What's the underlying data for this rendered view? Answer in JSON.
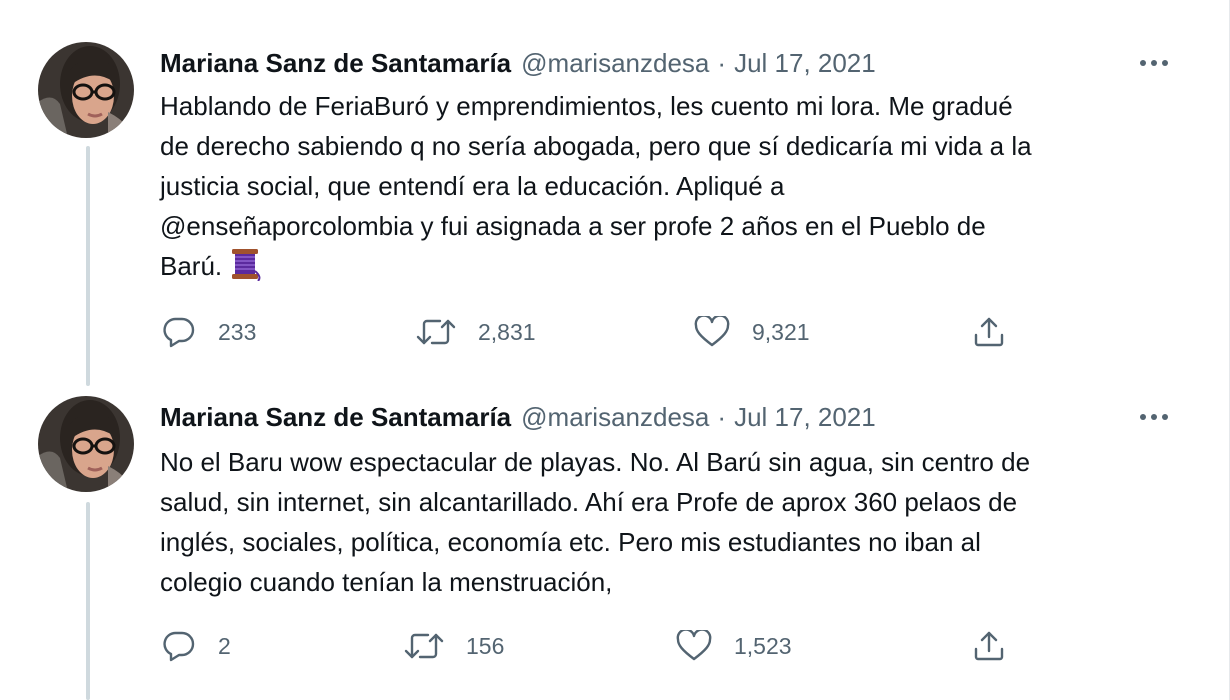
{
  "tweets": [
    {
      "author_name": "Mariana Sanz de Santamaría",
      "handle": "@marisanzdesa",
      "separator": "·",
      "date": "Jul 17, 2021",
      "text_lines": [
        "Hablando de FeriaBuró y emprendimientos, les cuento mi lora. Me gradué",
        "de derecho sabiendo q no sería abogada, pero que sí dedicaría mi vida a la",
        "justicia social, que entendí era la educación. Apliqué a",
        "@enseñaporcolombia y fui asignada a ser profe 2 años en el Pueblo de",
        "Barú."
      ],
      "emoji": "spool-of-thread",
      "replies": "233",
      "retweets": "2,831",
      "likes": "9,321"
    },
    {
      "author_name": "Mariana Sanz de Santamaría",
      "handle": "@marisanzdesa",
      "separator": "·",
      "date": "Jul 17, 2021",
      "text_lines": [
        "No el Baru wow espectacular de playas. No. Al Barú sin agua, sin centro de",
        "salud, sin internet, sin alcantarillado. Ahí era Profe de aprox 360 pelaos de",
        "inglés, sociales, política, economía etc. Pero mis estudiantes no iban al",
        "colegio cuando tenían la menstruación,"
      ],
      "replies": "2",
      "retweets": "156",
      "likes": "1,523"
    }
  ],
  "icons": [
    "reply-icon",
    "retweet-icon",
    "like-icon",
    "share-icon",
    "more-icon"
  ],
  "colors": {
    "text_primary": "#0f1419",
    "text_secondary": "#536471",
    "thread_line": "#cfd9de",
    "spool_purple": "#5b2a9e"
  }
}
